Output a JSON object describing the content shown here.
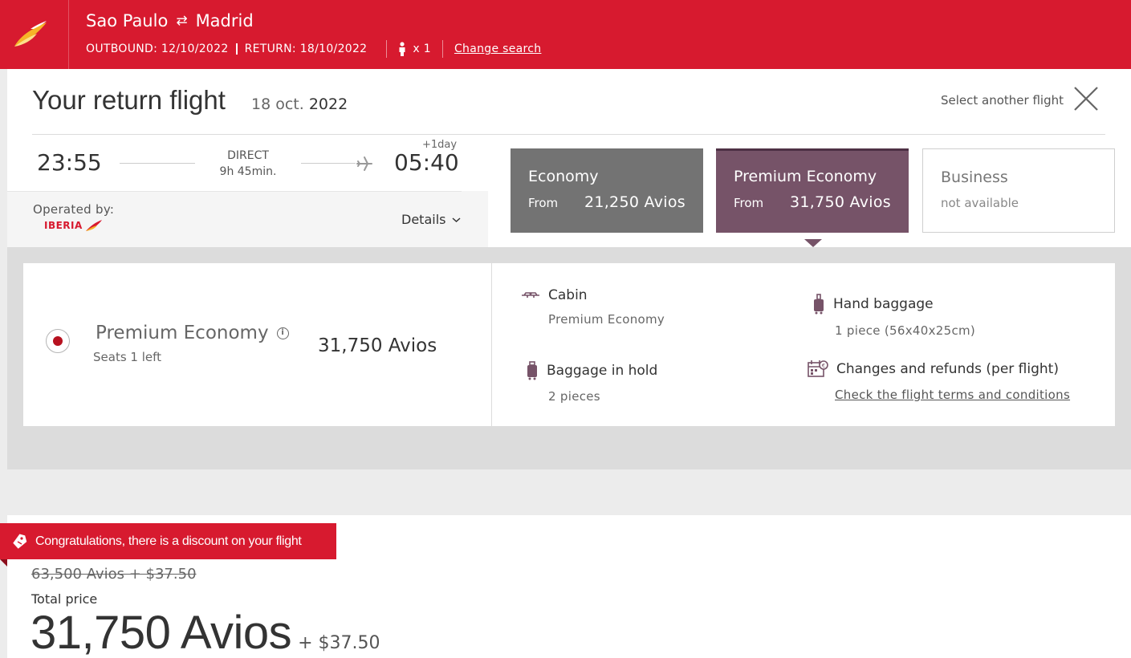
{
  "header": {
    "origin": "Sao Paulo",
    "swap_glyph": "⇄",
    "destination": "Madrid",
    "outbound": "OUTBOUND: 12/10/2022",
    "return": "RETURN: 18/10/2022",
    "passengers": "x 1",
    "change_search": "Change search"
  },
  "flight": {
    "title": "Your return flight",
    "date_day": "18 oct.",
    "date_year": "2022",
    "select_another": "Select another flight",
    "departure": "23:55",
    "arrival": "05:40",
    "plus_day": "+1day",
    "stops": "DIRECT",
    "duration": "9h 45min.",
    "operated_by": "Operated by:",
    "carrier": "IBERIA",
    "details": "Details"
  },
  "fares": [
    {
      "name": "Economy",
      "from": "From",
      "price": "21,250 Avios"
    },
    {
      "name": "Premium Economy",
      "from": "From",
      "price": "31,750 Avios"
    },
    {
      "name": "Business",
      "status": "not available"
    }
  ],
  "selected": {
    "cabin": "Premium Economy",
    "seats": "Seats 1 left",
    "price": "31,750 Avios",
    "features": {
      "cabin_title": "Cabin",
      "cabin_value": "Premium Economy",
      "hold_title": "Baggage in hold",
      "hold_value": "2 pieces",
      "hand_title": "Hand baggage",
      "hand_value": "1 piece (56x40x25cm)",
      "changes_title": "Changes and refunds (per flight)",
      "changes_link": "Check the flight terms and conditions"
    }
  },
  "price": {
    "discount_banner": "Congratulations, there is a discount on your flight",
    "old_price": "63,500 Avios + $37.50",
    "total_label": "Total price",
    "total_avios": "31,750 Avios",
    "total_cash": "+ $37.50"
  },
  "colors": {
    "brand_red": "#d71a2f",
    "premium_purple": "#765368",
    "economy_grey": "#737373"
  },
  "icons": [
    "airline-logo-icon",
    "swap-icon",
    "passenger-icon",
    "close-icon",
    "plane-icon",
    "chevron-down-icon",
    "info-icon",
    "cabin-icon",
    "suitcase-icon",
    "calendar-icon",
    "tag-icon"
  ]
}
